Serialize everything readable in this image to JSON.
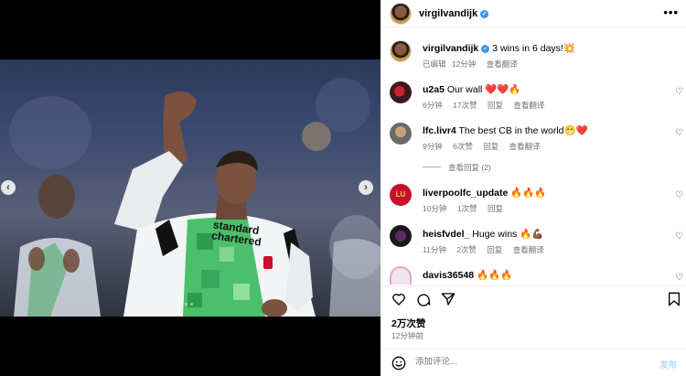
{
  "post": {
    "author": "virgilvandijk",
    "caption": "3 wins in 6 days!",
    "caption_emoji": "💥",
    "edited_label": "已编辑",
    "caption_time": "12分钟",
    "translate_label": "查看翻译",
    "likes": "2万次赞",
    "posted": "12分钟前"
  },
  "comments": [
    {
      "user": "u2a5",
      "text": "Our wall ❤️❤️🔥",
      "time": "6分钟",
      "likes": "17次赞",
      "reply": "回复",
      "translate": "查看翻译"
    },
    {
      "user": "lfc.livr4",
      "text": "The best CB in the world😁❤️",
      "time": "9分钟",
      "likes": "6次赞",
      "reply": "回复",
      "translate": "查看翻译"
    },
    {
      "user": "liverpoolfc_update",
      "text": "🔥🔥🔥",
      "time": "10分钟",
      "likes": "1次赞",
      "reply": "回复"
    },
    {
      "user": "heisfvdel_",
      "text": "Huge wins 🔥💪🏾",
      "time": "11分钟",
      "likes": "2次赞",
      "reply": "回复",
      "translate": "查看翻译"
    },
    {
      "user": "davis36548",
      "text": "🔥🔥🔥"
    }
  ],
  "view_replies": "查看回复 (2)",
  "add_comment": {
    "placeholder": "添加评论...",
    "post_label": "发布"
  },
  "shirt": {
    "sponsor_line1": "standard",
    "sponsor_line2": "chartered"
  },
  "nav": {
    "prev": "‹",
    "next": "›"
  },
  "colors": {
    "verified": "#3897f0",
    "post_button": "#b3dbff",
    "kit_green": "#4bbf6a"
  }
}
